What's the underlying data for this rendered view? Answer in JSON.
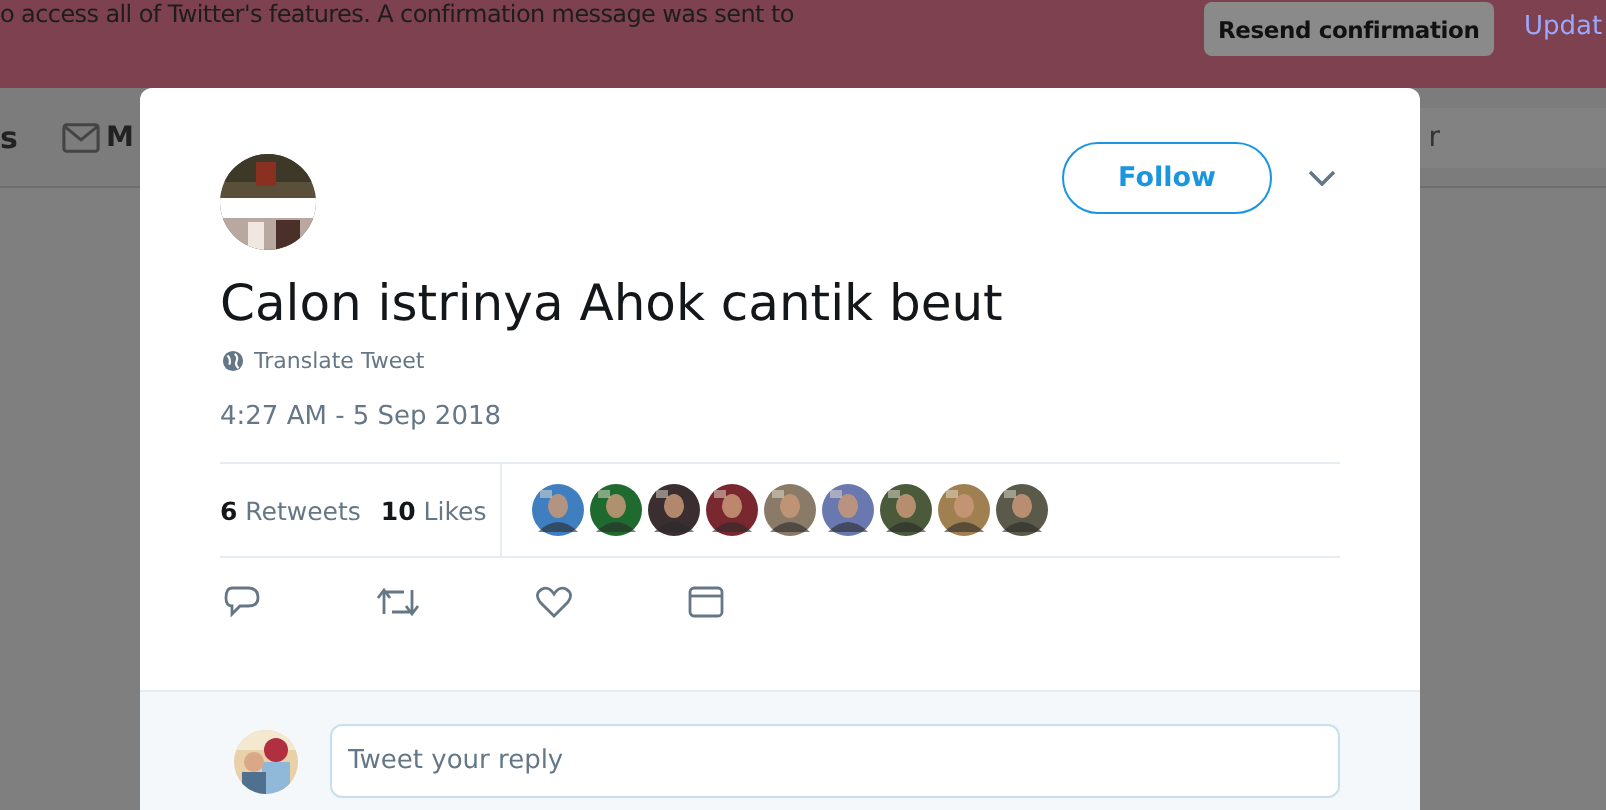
{
  "banner": {
    "message": "o access all of Twitter's features. A confirmation message was sent to",
    "button": "Resend confirmation",
    "link": "Updat"
  },
  "nav": {
    "left_text": "s",
    "messages_label": "M",
    "right_text": "r"
  },
  "tweet": {
    "follow_button": "Follow",
    "text": "Calon istrinya Ahok cantik beut",
    "translate": "Translate Tweet",
    "timestamp": "4:27 AM - 5 Sep 2018",
    "stats": [
      {
        "count": "6",
        "label": "Retweets"
      },
      {
        "count": "10",
        "label": "Likes"
      }
    ]
  },
  "reply": {
    "placeholder": "Tweet your reply"
  }
}
